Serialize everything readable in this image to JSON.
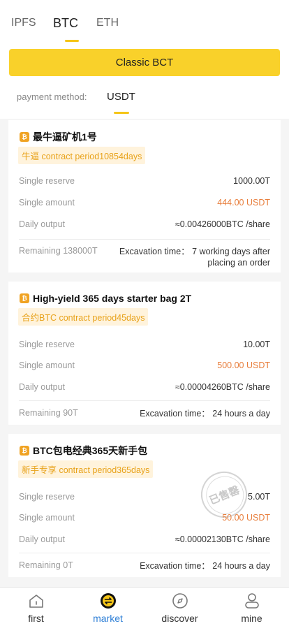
{
  "tabs": [
    {
      "label": "IPFS"
    },
    {
      "label": "BTC"
    },
    {
      "label": "ETH"
    }
  ],
  "active_tab": "BTC",
  "classic_button_label": "Classic BCT",
  "payment": {
    "label": "payment method:",
    "value": "USDT"
  },
  "accent_color": "#f9d12a",
  "coin_glyph": "₿",
  "products": [
    {
      "title": "最牛逼矿机1号",
      "tag": "牛逼 contract period10854days",
      "reserve_label": "Single reserve",
      "reserve_value": "1000.00T",
      "amount_label": "Single amount",
      "amount_value": "444.00 USDT",
      "output_label": "Daily output",
      "output_value": "≈0.00426000BTC /share",
      "remaining": "Remaining 138000T",
      "excavation_label": "Excavation time：",
      "excavation_value": "7 working days after placing an order"
    },
    {
      "title": "High-yield 365 days starter bag 2T",
      "tag": "合约BTC contract period45days",
      "reserve_label": "Single reserve",
      "reserve_value": "10.00T",
      "amount_label": "Single amount",
      "amount_value": "500.00 USDT",
      "output_label": "Daily output",
      "output_value": "≈0.00004260BTC /share",
      "remaining": "Remaining 90T",
      "excavation_label": "Excavation time：",
      "excavation_value": "24 hours a day"
    },
    {
      "title": "BTC包电经典365天新手包",
      "tag": "新手专享 contract period365days",
      "reserve_label": "Single reserve",
      "reserve_value": "5.00T",
      "amount_label": "Single amount",
      "amount_value": "50.00 USDT",
      "output_label": "Daily output",
      "output_value": "≈0.00002130BTC /share",
      "remaining": "Remaining 0T",
      "excavation_label": "Excavation time：",
      "excavation_value": "24 hours a day",
      "stamp": "已售罄"
    }
  ],
  "nav": [
    {
      "label": "first",
      "icon": "home-icon"
    },
    {
      "label": "market",
      "icon": "exchange-icon"
    },
    {
      "label": "discover",
      "icon": "compass-icon"
    },
    {
      "label": "mine",
      "icon": "user-icon"
    }
  ],
  "active_nav": "market"
}
